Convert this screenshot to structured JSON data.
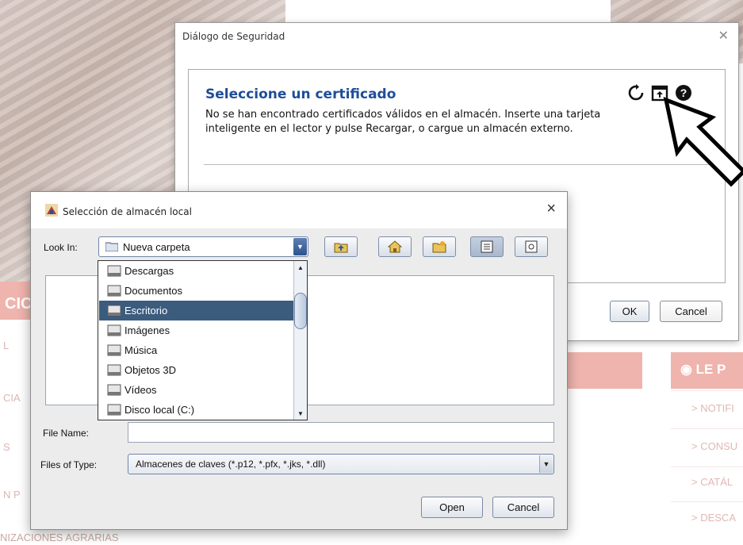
{
  "background": {
    "left_text": "CIC",
    "side_items": [
      "L",
      "CIA",
      "S",
      "N P"
    ],
    "right_heading": "LE P",
    "right_menu": [
      "> NOTIFI",
      "> CONSU",
      "> CATÁL",
      "> DESCA"
    ],
    "bottom_text": "NIZACIONES AGRARIAS"
  },
  "security_dialog": {
    "title": "Diálogo de Seguridad",
    "heading": "Seleccione un certificado",
    "message": "No se han encontrado certificados válidos en el almacén. Inserte una tarjeta inteligente en el lector y pulse Recargar, o cargue un almacén externo.",
    "ok_label": "OK",
    "cancel_label": "Cancel",
    "icons": [
      "refresh-icon",
      "open-store-icon",
      "help-icon"
    ]
  },
  "file_chooser": {
    "title": "Selección de almacén local",
    "look_in_label": "Look In:",
    "look_in_value": "Nueva carpeta",
    "file_name_label": "File Name:",
    "file_name_value": "",
    "files_of_type_label": "Files of Type:",
    "files_of_type_value": "Almacenes de claves (*.p12, *.pfx, *.jks, *.dll)",
    "open_label": "Open",
    "cancel_label": "Cancel",
    "toolbar_icons": [
      "up-folder-icon",
      "home-icon",
      "new-folder-icon",
      "list-view-icon",
      "details-view-icon"
    ],
    "dropdown_items": [
      {
        "label": "Descargas",
        "selected": false
      },
      {
        "label": "Documentos",
        "selected": false
      },
      {
        "label": "Escritorio",
        "selected": true
      },
      {
        "label": "Imágenes",
        "selected": false
      },
      {
        "label": "Música",
        "selected": false
      },
      {
        "label": "Objetos 3D",
        "selected": false
      },
      {
        "label": "Vídeos",
        "selected": false
      },
      {
        "label": "Disco local (C:)",
        "selected": false
      }
    ]
  },
  "colors": {
    "heading_blue": "#1f4e99",
    "selection": "#3c5c7e",
    "brand_red": "#efb4ad"
  }
}
